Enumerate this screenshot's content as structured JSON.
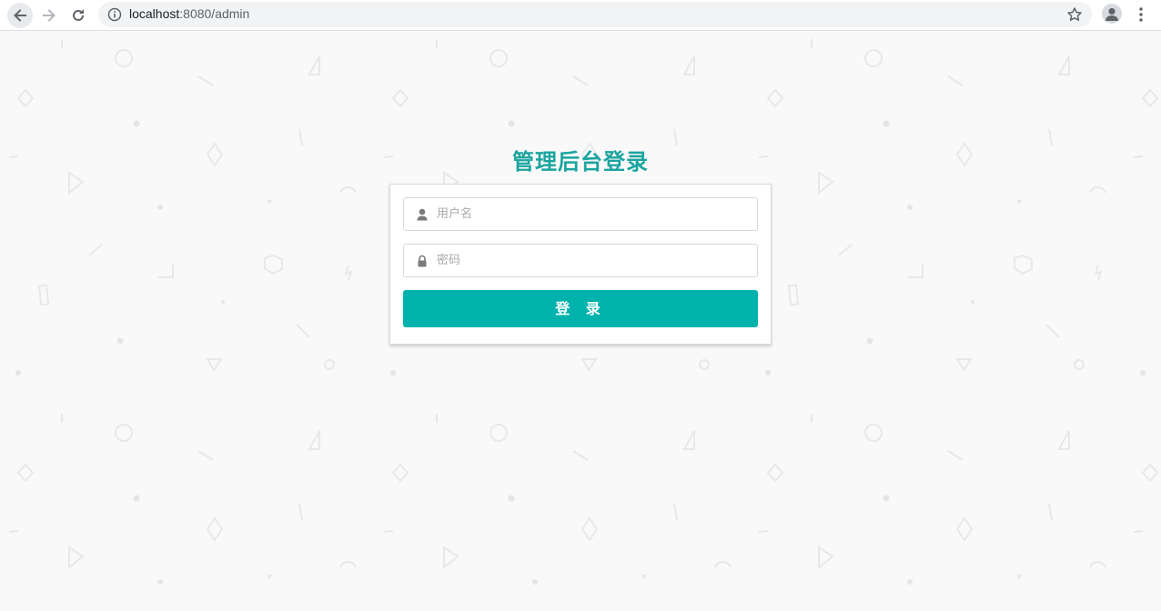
{
  "browser": {
    "url_host": "localhost",
    "url_rest": ":8080/admin"
  },
  "login": {
    "title": "管理后台登录",
    "username_placeholder": "用户名",
    "password_placeholder": "密码",
    "submit_label": "登 录"
  },
  "colors": {
    "accent": "#00b2ac",
    "title": "#1aa59f",
    "background": "#f9f9f9"
  },
  "icons": {
    "username": "user-icon",
    "password": "lock-icon"
  }
}
